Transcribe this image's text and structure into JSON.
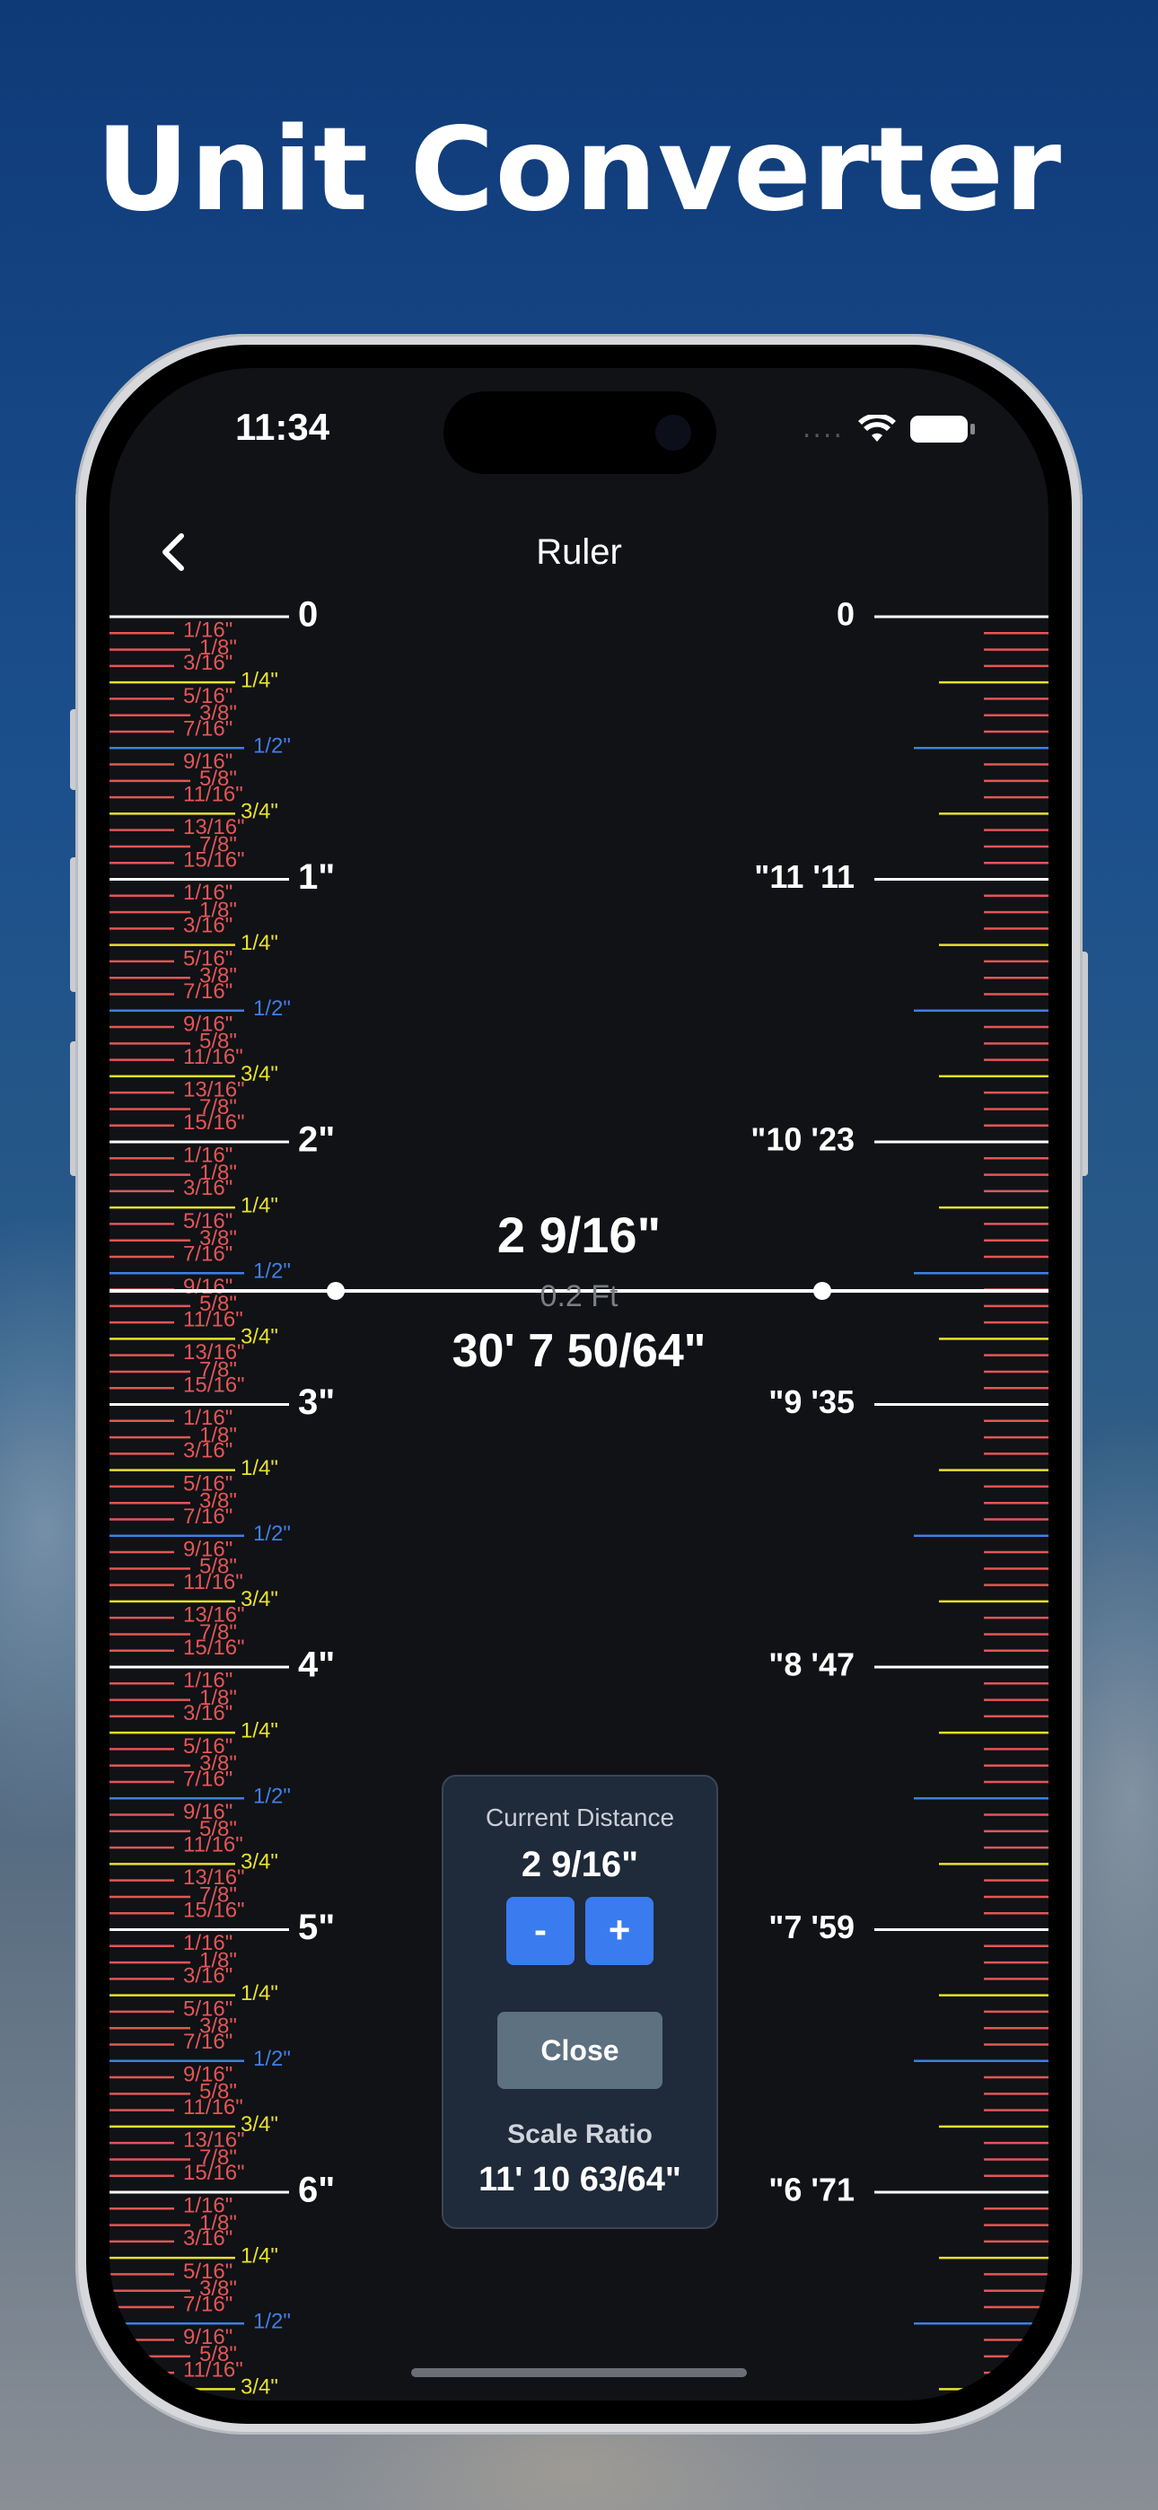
{
  "hero": {
    "title": "Unit Converter"
  },
  "status_bar": {
    "time": "11:34",
    "signal": "...."
  },
  "nav": {
    "back_icon": "chevron-left-icon",
    "title": "Ruler"
  },
  "ruler_left": {
    "major_labels": [
      "0",
      "1\"",
      "2\"",
      "3\"",
      "4\"",
      "5\"",
      "6\""
    ],
    "fraction_labels": [
      "1/16\"",
      "1/8\"",
      "3/16\"",
      "1/4\"",
      "5/16\"",
      "3/8\"",
      "7/16\"",
      "1/2\"",
      "9/16\"",
      "5/8\"",
      "11/16\"",
      "3/4\"",
      "13/16\"",
      "7/8\"",
      "15/16\""
    ]
  },
  "ruler_right": {
    "major_labels": [
      "0",
      "\"11 '11",
      "\"10 '23",
      "\"9 '35",
      "\"8 '47",
      "\"7 '59",
      "\"6 '71"
    ]
  },
  "colors": {
    "sixteenth": "#e35656",
    "quarter": "#e8e22a",
    "half": "#3f7fe6",
    "major": "#ffffff",
    "button_blue": "#3a7bf0",
    "close_button": "#5d7180"
  },
  "measurement": {
    "inches": "2 9/16\"",
    "feet": "0.2 Ft",
    "scaled": "30' 7 50/64\""
  },
  "panel": {
    "current_distance_label": "Current Distance",
    "current_distance_value": "2 9/16\"",
    "minus_label": "-",
    "plus_label": "+",
    "close_label": "Close",
    "scale_ratio_label": "Scale Ratio",
    "scale_ratio_value": "11' 10 63/64\""
  }
}
